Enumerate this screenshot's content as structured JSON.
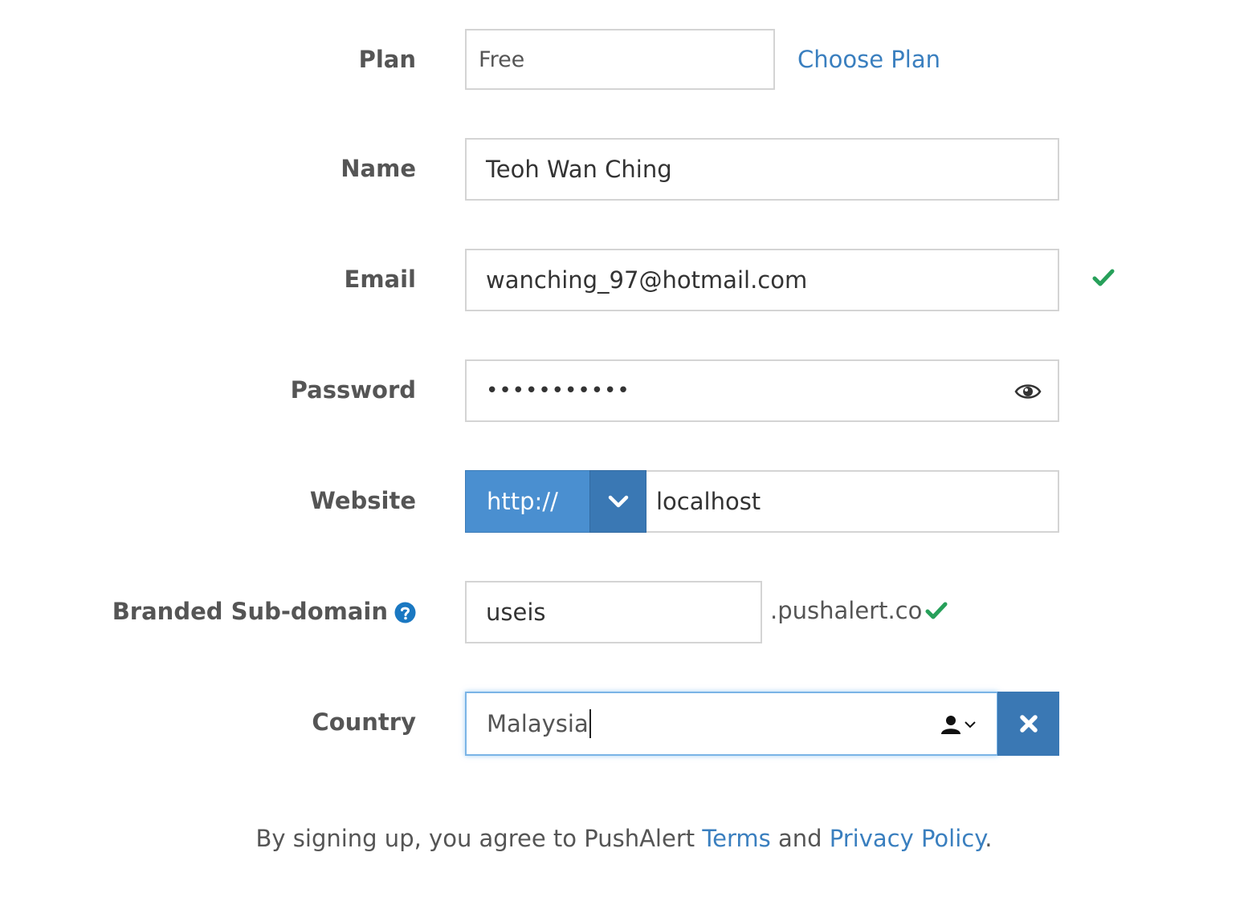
{
  "plan": {
    "label": "Plan",
    "value": "Free",
    "link": "Choose Plan"
  },
  "name": {
    "label": "Name",
    "value": "Teoh Wan Ching"
  },
  "email": {
    "label": "Email",
    "value": "wanching_97@hotmail.com",
    "valid": true
  },
  "password": {
    "label": "Password",
    "masked_value": "•••••••••••",
    "icon": "eye-icon"
  },
  "website": {
    "label": "Website",
    "protocol": "http://",
    "value": "localhost"
  },
  "subdomain": {
    "label": "Branded Sub-domain",
    "help_icon": "question-circle-icon",
    "value": "useis",
    "suffix": ".pushalert.co",
    "valid": true
  },
  "country": {
    "label": "Country",
    "value": "Malaysia",
    "icon": "user-icon",
    "clear_icon": "close-icon"
  },
  "footer": {
    "prefix": "By signing up, you agree to PushAlert ",
    "terms": "Terms",
    "and": " and ",
    "privacy": "Privacy Policy",
    "suffix": "."
  },
  "colors": {
    "link": "#3a7fbf",
    "accent": "#4a8fd0",
    "accent_dark": "#3a78b4",
    "success": "#27a05a",
    "help": "#1a78c2"
  }
}
